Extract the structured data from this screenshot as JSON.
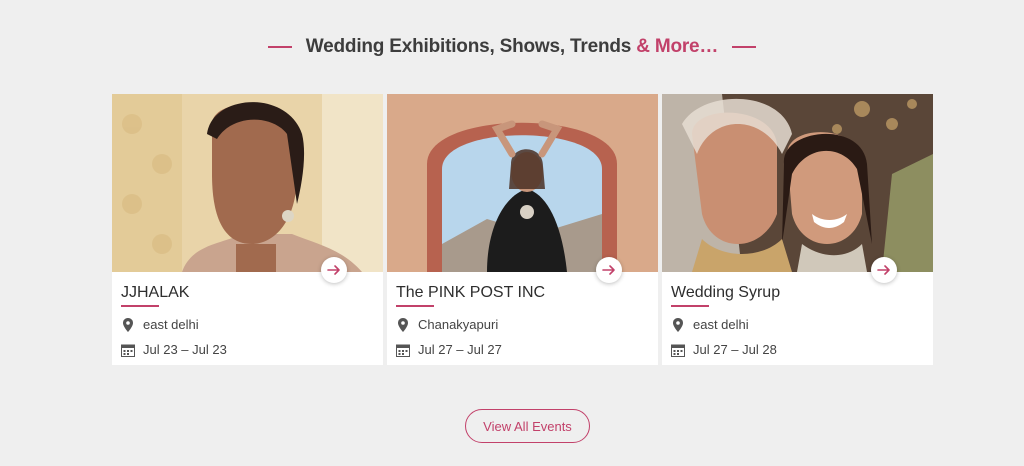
{
  "section": {
    "title_main": "Wedding Exhibitions, Shows, Trends",
    "title_accent": "& More…"
  },
  "colors": {
    "accent": "#c2416a",
    "background": "#efefef"
  },
  "events": [
    {
      "name": "JJHALAK",
      "location": "east delhi",
      "dates": "Jul 23 – Jul 23"
    },
    {
      "name": "The PINK POST INC",
      "location": "Chanakyapuri",
      "dates": "Jul 27 – Jul 27"
    },
    {
      "name": "Wedding Syrup",
      "location": "east delhi",
      "dates": "Jul 27 – Jul 28"
    }
  ],
  "icons": {
    "location": "map-pin-icon",
    "date": "calendar-icon",
    "arrow": "arrow-right-icon"
  },
  "view_all_label": "View All Events"
}
